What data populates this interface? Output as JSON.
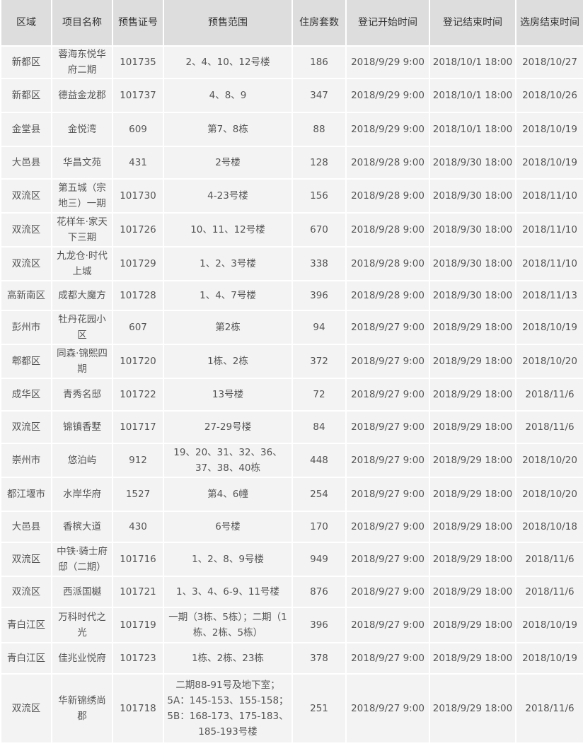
{
  "table": {
    "headers": [
      "区域",
      "项目名称",
      "预售证号",
      "预售范围",
      "住房套数",
      "登记开始时间",
      "登记结束时间",
      "选房结束时间"
    ],
    "rows": [
      {
        "district": "新都区",
        "project": "蓉海东悦华府二期",
        "license": "101735",
        "scope": "2、4、10、12号楼",
        "units": "186",
        "reg_start": "2018/9/29 9:00",
        "reg_end": "2018/10/1 18:00",
        "select_end": "2018/10/27"
      },
      {
        "district": "新都区",
        "project": "德益金龙郡",
        "license": "101737",
        "scope": "4、8、9",
        "units": "347",
        "reg_start": "2018/9/29 9:00",
        "reg_end": "2018/10/1 18:00",
        "select_end": "2018/10/26"
      },
      {
        "district": "金堂县",
        "project": "金悦湾",
        "license": "609",
        "scope": "第7、8栋",
        "units": "88",
        "reg_start": "2018/9/29 9:00",
        "reg_end": "2018/10/1 18:00",
        "select_end": "2018/10/19"
      },
      {
        "district": "大邑县",
        "project": "华昌文苑",
        "license": "431",
        "scope": "2号楼",
        "units": "128",
        "reg_start": "2018/9/28 9:00",
        "reg_end": "2018/9/30 18:00",
        "select_end": "2018/10/19"
      },
      {
        "district": "双流区",
        "project": "第五城（宗地三）一期",
        "license": "101730",
        "scope": "4-23号楼",
        "units": "156",
        "reg_start": "2018/9/28 9:00",
        "reg_end": "2018/9/30 18:00",
        "select_end": "2018/11/10"
      },
      {
        "district": "双流区",
        "project": "花样年·家天下三期",
        "license": "101726",
        "scope": "10、11、12号楼",
        "units": "670",
        "reg_start": "2018/9/28 9:00",
        "reg_end": "2018/9/30 18:00",
        "select_end": "2018/11/10"
      },
      {
        "district": "双流区",
        "project": "九龙仓·时代上城",
        "license": "101729",
        "scope": "1、2、3号楼",
        "units": "338",
        "reg_start": "2018/9/28 9:00",
        "reg_end": "2018/9/30 18:00",
        "select_end": "2018/11/10"
      },
      {
        "district": "高新南区",
        "project": "成都大魔方",
        "license": "101728",
        "scope": "1、4、7号楼",
        "units": "396",
        "reg_start": "2018/9/28 9:00",
        "reg_end": "2018/9/30 18:00",
        "select_end": "2018/11/13"
      },
      {
        "district": "彭州市",
        "project": "牡丹花园小区",
        "license": "607",
        "scope": "第2栋",
        "units": "94",
        "reg_start": "2018/9/27 9:00",
        "reg_end": "2018/9/29 18:00",
        "select_end": "2018/10/19"
      },
      {
        "district": "郫都区",
        "project": "同森·锦熙四期",
        "license": "101720",
        "scope": "1栋、2栋",
        "units": "372",
        "reg_start": "2018/9/27 9:00",
        "reg_end": "2018/9/29 18:00",
        "select_end": "2018/10/20"
      },
      {
        "district": "成华区",
        "project": "青秀名邸",
        "license": "101722",
        "scope": "13号楼",
        "units": "72",
        "reg_start": "2018/9/27 9:00",
        "reg_end": "2018/9/29 18:00",
        "select_end": "2018/11/6"
      },
      {
        "district": "双流区",
        "project": "锦镇香墅",
        "license": "101717",
        "scope": "27-29号楼",
        "units": "84",
        "reg_start": "2018/9/27 9:00",
        "reg_end": "2018/9/29 18:00",
        "select_end": "2018/11/6"
      },
      {
        "district": "崇州市",
        "project": "悠泊屿",
        "license": "912",
        "scope": "19、20、31、32、36、37、38、40栋",
        "units": "448",
        "reg_start": "2018/9/27 9:00",
        "reg_end": "2018/9/29 18:00",
        "select_end": "2018/10/20"
      },
      {
        "district": "都江堰市",
        "project": "水岸华府",
        "license": "1527",
        "scope": "第4、6幢",
        "units": "254",
        "reg_start": "2018/9/27 9:00",
        "reg_end": "2018/9/29 18:00",
        "select_end": "2018/10/20"
      },
      {
        "district": "大邑县",
        "project": "香槟大道",
        "license": "430",
        "scope": "6号楼",
        "units": "170",
        "reg_start": "2018/9/27 9:00",
        "reg_end": "2018/9/29 18:00",
        "select_end": "2018/10/18"
      },
      {
        "district": "双流区",
        "project": "中铁·骑士府邸（二期）",
        "license": "101716",
        "scope": "1、2、8、9号楼",
        "units": "949",
        "reg_start": "2018/9/27 9:00",
        "reg_end": "2018/9/29 18:00",
        "select_end": "2018/11/6"
      },
      {
        "district": "双流区",
        "project": "西派国樾",
        "license": "101721",
        "scope": "1、3、4、6-9、11号楼",
        "units": "876",
        "reg_start": "2018/9/27 9:00",
        "reg_end": "2018/9/29 18:00",
        "select_end": "2018/11/6"
      },
      {
        "district": "青白江区",
        "project": "万科时代之光",
        "license": "101719",
        "scope": "一期（3栋、5栋）；二期（1栋、2栋、5栋）",
        "units": "396",
        "reg_start": "2018/9/27 9:00",
        "reg_end": "2018/9/29 18:00",
        "select_end": "2018/10/19"
      },
      {
        "district": "青白江区",
        "project": "佳兆业悦府",
        "license": "101723",
        "scope": "1栋、2栋、23栋",
        "units": "378",
        "reg_start": "2018/9/27 9:00",
        "reg_end": "2018/9/29 18:00",
        "select_end": "2018/10/19"
      },
      {
        "district": "双流区",
        "project": "华新锦绣尚郡",
        "license": "101718",
        "scope": "二期88-91号及地下室；5A：145-153、155-158；5B：168-173、175-183、185-193号楼",
        "units": "251",
        "reg_start": "2018/9/27 9:00",
        "reg_end": "2018/9/29 18:00",
        "select_end": "2018/11/6"
      }
    ]
  }
}
